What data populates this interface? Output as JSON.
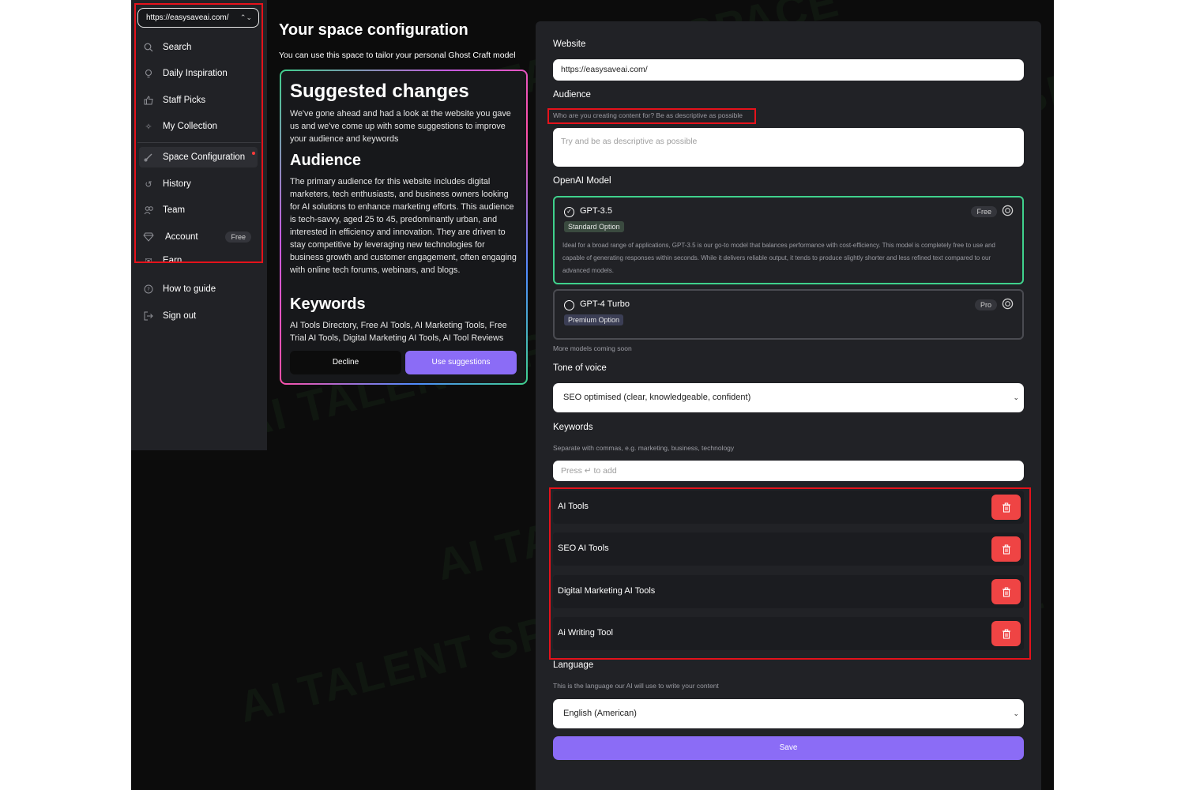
{
  "colors": {
    "accent": "#8b6cf6",
    "danger": "#ef4444",
    "success": "#3fd18c",
    "highlight": "#e5121b"
  },
  "watermark": "AI TALENT SPACE",
  "sidebar": {
    "site_url": "https://easysaveai.com/",
    "items": [
      {
        "label": "Search",
        "icon": "search-icon"
      },
      {
        "label": "Daily Inspiration",
        "icon": "lightbulb-icon"
      },
      {
        "label": "Staff Picks",
        "icon": "thumbs-up-icon"
      },
      {
        "label": "My Collection",
        "icon": "sparkle-icon"
      },
      {
        "label": "Space Configuration",
        "icon": "brush-icon"
      },
      {
        "label": "History",
        "icon": "history-icon"
      },
      {
        "label": "Team",
        "icon": "team-icon"
      },
      {
        "label": "Account",
        "icon": "diamond-icon",
        "badge": "Free"
      },
      {
        "label": "Earn",
        "icon": "mail-icon"
      },
      {
        "label": "How to guide",
        "icon": "help-icon"
      },
      {
        "label": "Sign out",
        "icon": "sign-out-icon"
      }
    ]
  },
  "main": {
    "title": "Your space configuration",
    "subtitle": "You can use this space to tailor your personal Ghost Craft model"
  },
  "suggestions": {
    "heading": "Suggested changes",
    "intro": "We've gone ahead and had a look at the website you gave us and we've come up with some suggestions to improve your audience and keywords",
    "audience_heading": "Audience",
    "audience_text": "The primary audience for this website includes digital marketers, tech enthusiasts, and business owners looking for AI solutions to enhance marketing efforts. This audience is tech-savvy, aged 25 to 45, predominantly urban, and interested in efficiency and innovation. They are driven to stay competitive by leveraging new technologies for business growth and customer engagement, often engaging with online tech forums, webinars, and blogs.",
    "keywords_heading": "Keywords",
    "keywords_text": "AI Tools Directory, Free AI Tools, AI Marketing Tools, Free Trial AI Tools, Digital Marketing AI Tools, AI Tool Reviews",
    "decline_label": "Decline",
    "use_label": "Use suggestions"
  },
  "form": {
    "website_label": "Website",
    "website_value": "https://easysaveai.com/",
    "audience_label": "Audience",
    "audience_hint": "Who are you creating content for? Be as descriptive as possible",
    "audience_placeholder": "Try and be as descriptive as possible",
    "model_label": "OpenAI Model",
    "models": [
      {
        "name": "GPT-3.5",
        "option": "Standard Option",
        "badge": "Free",
        "selected": true,
        "description": "Ideal for a broad range of applications, GPT-3.5 is our go-to model that balances performance with cost-efficiency. This model is completely free to use and capable of generating responses within seconds. While it delivers reliable output, it tends to produce slightly shorter and less refined text compared to our advanced models."
      },
      {
        "name": "GPT-4 Turbo",
        "option": "Premium Option",
        "badge": "Pro",
        "selected": false
      }
    ],
    "more_models": "More models coming soon",
    "tone_label": "Tone of voice",
    "tone_value": "SEO optimised (clear, knowledgeable, confident)",
    "keywords_label": "Keywords",
    "keywords_hint": "Separate with commas, e.g. marketing, business, technology",
    "keywords_placeholder": "Press ↵ to add",
    "keywords": [
      "AI Tools",
      "SEO AI Tools",
      "Digital Marketing AI Tools",
      "Ai Writing Tool"
    ],
    "language_label": "Language",
    "language_hint": "This is the language our AI will use to write your content",
    "language_value": "English (American)",
    "save_label": "Save"
  }
}
